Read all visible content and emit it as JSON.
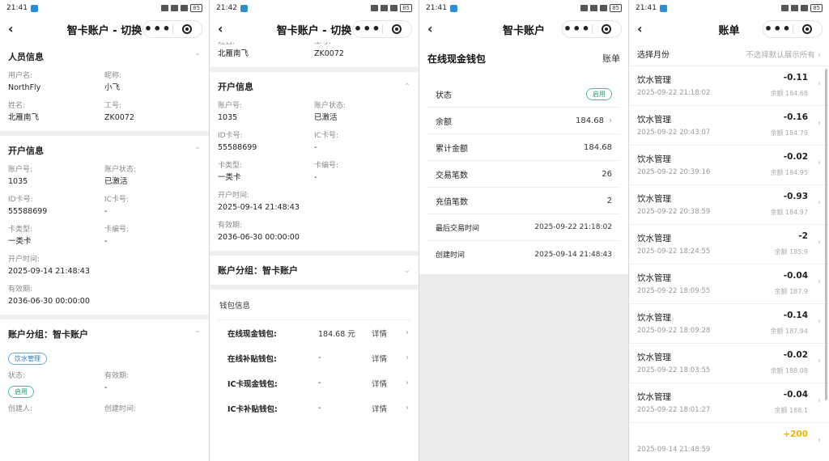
{
  "status": {
    "time1": "21:41",
    "time2": "21:42",
    "time3": "21:41",
    "time4": "21:41",
    "battery": "85"
  },
  "nav": {
    "switch_title": "智卡账户 - 切换",
    "account_title": "智卡账户",
    "bill_title": "账单"
  },
  "s1": {
    "person_section": "人员信息",
    "username_label": "用户名:",
    "username": "NorthFly",
    "nickname_label": "昵称:",
    "nickname": "小飞",
    "name_label": "姓名:",
    "name": "北雁南飞",
    "empno_label": "工号:",
    "empno": "ZK0072",
    "open_section": "开户信息",
    "acctno_label": "账户号:",
    "acctno": "1035",
    "acctstatus_label": "账户状态:",
    "acctstatus": "已激活",
    "idcard_label": "ID卡号:",
    "idcard": "55588699",
    "iccard_label": "IC卡号:",
    "iccard": "-",
    "cardtype_label": "卡类型:",
    "cardtype": "一类卡",
    "cardno_label": "卡编号:",
    "cardno": "-",
    "opentime_label": "开户时间:",
    "opentime": "2025-09-14 21:48:43",
    "expire_label": "有效期:",
    "expire": "2036-06-30 00:00:00",
    "group_section": "账户分组：智卡账户",
    "group_tag": "饮水管理",
    "state_label": "状态:",
    "state_tag": "启用",
    "gexpire_label": "有效期:",
    "gexpire": "-",
    "creator_label": "创建人:",
    "createtime_label": "创建时间:"
  },
  "s2": {
    "name_label": "姓名:",
    "name": "北雁南飞",
    "empno_label": "工号:",
    "empno": "ZK0072",
    "open_section": "开户信息",
    "acctno_label": "账户号:",
    "acctno": "1035",
    "acctstatus_label": "账户状态:",
    "acctstatus": "已激活",
    "idcard_label": "ID卡号:",
    "idcard": "55588699",
    "iccard_label": "IC卡号:",
    "iccard": "-",
    "cardtype_label": "卡类型:",
    "cardtype": "一类卡",
    "cardno_label": "卡编号:",
    "cardno": "-",
    "opentime_label": "开户时间:",
    "opentime": "2025-09-14 21:48:43",
    "expire_label": "有效期:",
    "expire": "2036-06-30 00:00:00",
    "group_section": "账户分组：智卡账户",
    "wallet_section": "钱包信息",
    "wallets": [
      {
        "name": "在线现金钱包:",
        "value": "184.68 元",
        "detail": "详情"
      },
      {
        "name": "在线补贴钱包:",
        "value": "-",
        "detail": "详情"
      },
      {
        "name": "IC卡现金钱包:",
        "value": "-",
        "detail": "详情"
      },
      {
        "name": "IC卡补贴钱包:",
        "value": "-",
        "detail": "详情"
      }
    ]
  },
  "s3": {
    "wallet_name": "在线现金钱包",
    "bill_link": "账单",
    "status_label": "状态",
    "status_tag": "启用",
    "balance_label": "余额",
    "balance": "184.68",
    "total_label": "累计金额",
    "total": "184.68",
    "trade_count_label": "交易笔数",
    "trade_count": "26",
    "recharge_count_label": "充值笔数",
    "recharge_count": "2",
    "last_trade_label": "最后交易时间",
    "last_trade": "2025-09-22 21:18:02",
    "create_time_label": "创建时间",
    "create_time": "2025-09-14 21:48:43"
  },
  "s4": {
    "filter_label": "选择月份",
    "filter_placeholder": "不选择默认展示所有",
    "items": [
      {
        "title": "饮水管理",
        "date": "2025-09-22 21:18:02",
        "amount": "-0.11",
        "balance": "余额 184.68"
      },
      {
        "title": "饮水管理",
        "date": "2025-09-22 20:43:07",
        "amount": "-0.16",
        "balance": "余额 184.79"
      },
      {
        "title": "饮水管理",
        "date": "2025-09-22 20:39:16",
        "amount": "-0.02",
        "balance": "余额 184.95"
      },
      {
        "title": "饮水管理",
        "date": "2025-09-22 20:38:59",
        "amount": "-0.93",
        "balance": "余额 184.97"
      },
      {
        "title": "饮水管理",
        "date": "2025-09-22 18:24:55",
        "amount": "-2",
        "balance": "余额 185.9"
      },
      {
        "title": "饮水管理",
        "date": "2025-09-22 18:09:55",
        "amount": "-0.04",
        "balance": "余额 187.9"
      },
      {
        "title": "饮水管理",
        "date": "2025-09-22 18:09:28",
        "amount": "-0.14",
        "balance": "余额 187.94"
      },
      {
        "title": "饮水管理",
        "date": "2025-09-22 18:03:55",
        "amount": "-0.02",
        "balance": "余额 188.08"
      },
      {
        "title": "饮水管理",
        "date": "2025-09-22 18:01:27",
        "amount": "-0.04",
        "balance": "余额 188.1"
      },
      {
        "title": "",
        "date": "2025-09-14 21:48:59",
        "amount": "+200",
        "balance": ""
      }
    ]
  },
  "colors": {
    "accent_blue": "#2a7dbd",
    "enabled_green": "#28a06a",
    "recharge_yellow": "#f0b400"
  }
}
